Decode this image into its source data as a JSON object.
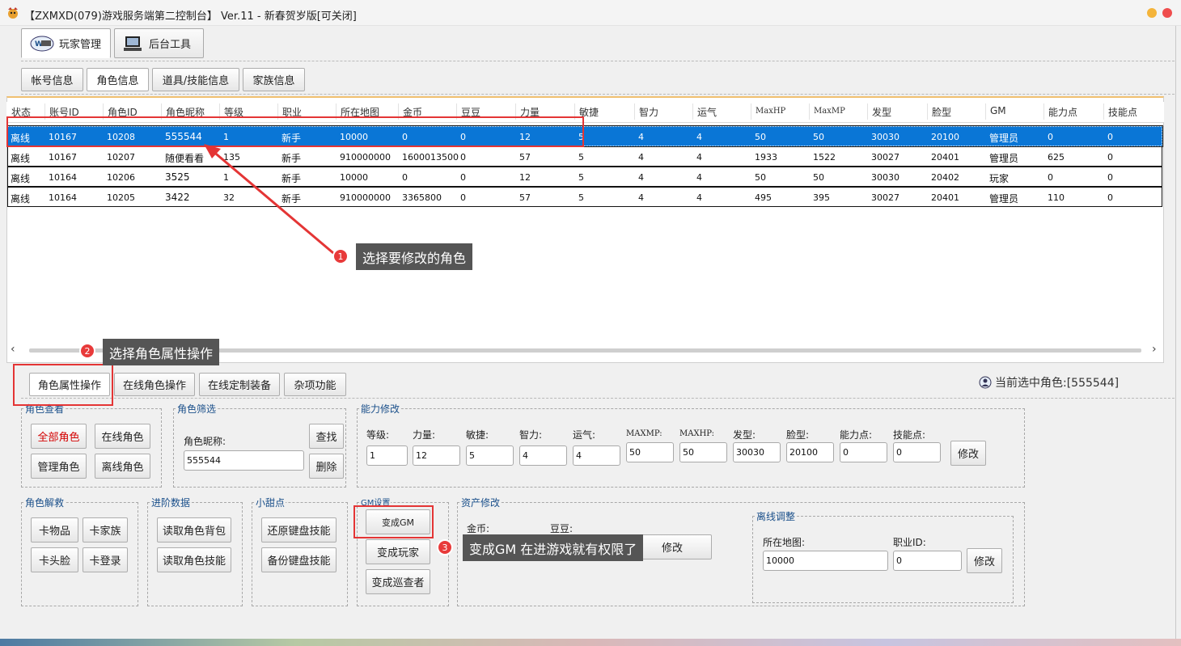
{
  "window": {
    "title": "【ZXMXD(079)游戏服务端第二控制台】 Ver.11 - 新春贺岁版[可关闭]"
  },
  "main_tabs": [
    {
      "label": "玩家管理",
      "icon": "player-manage-icon"
    },
    {
      "label": "后台工具",
      "icon": "computer-icon"
    }
  ],
  "sub_tabs": [
    "帐号信息",
    "角色信息",
    "道具/技能信息",
    "家族信息"
  ],
  "table": {
    "columns": [
      "状态",
      "账号ID",
      "角色ID",
      "角色昵称",
      "等级",
      "职业",
      "所在地图",
      "金币",
      "豆豆",
      "力量",
      "敏捷",
      "智力",
      "运气",
      "MaxHP",
      "MaxMP",
      "发型",
      "脸型",
      "GM",
      "能力点",
      "技能点"
    ],
    "rows": [
      [
        "离线",
        "10167",
        "10208",
        "555544",
        "1",
        "新手",
        "10000",
        "0",
        "0",
        "12",
        "5",
        "4",
        "4",
        "50",
        "50",
        "30030",
        "20100",
        "管理员",
        "0",
        "0"
      ],
      [
        "离线",
        "10167",
        "10207",
        "随便看看",
        "135",
        "新手",
        "910000000",
        "1600013500",
        "0",
        "57",
        "5",
        "4",
        "4",
        "1933",
        "1522",
        "30027",
        "20401",
        "管理员",
        "625",
        "0"
      ],
      [
        "离线",
        "10164",
        "10206",
        "3525",
        "1",
        "新手",
        "10000",
        "0",
        "0",
        "12",
        "5",
        "4",
        "4",
        "50",
        "50",
        "30030",
        "20402",
        "玩家",
        "0",
        "0"
      ],
      [
        "离线",
        "10164",
        "10205",
        "3422",
        "32",
        "新手",
        "910000000",
        "3365800",
        "0",
        "57",
        "5",
        "4",
        "4",
        "495",
        "395",
        "30027",
        "20401",
        "管理员",
        "110",
        "0"
      ]
    ]
  },
  "op_tabs": [
    "角色属性操作",
    "在线角色操作",
    "在线定制装备",
    "杂项功能"
  ],
  "selected_role": "当前选中角色:[555544]",
  "groups": {
    "view": {
      "title": "角色查看",
      "buttons": [
        "全部角色",
        "在线角色",
        "管理角色",
        "离线角色"
      ]
    },
    "filter": {
      "title": "角色筛选",
      "label": "角色昵称:",
      "value": "555544",
      "search": "查找",
      "delete": "删除"
    },
    "ability": {
      "title": "能力修改",
      "fields": [
        {
          "label": "等级:",
          "value": "1"
        },
        {
          "label": "力量:",
          "value": "12"
        },
        {
          "label": "敏捷:",
          "value": "5"
        },
        {
          "label": "智力:",
          "value": "4"
        },
        {
          "label": "运气:",
          "value": "4"
        },
        {
          "label": "MAXMP:",
          "value": "50"
        },
        {
          "label": "MAXHP:",
          "value": "50"
        },
        {
          "label": "发型:",
          "value": "30030"
        },
        {
          "label": "脸型:",
          "value": "20100"
        },
        {
          "label": "能力点:",
          "value": "0"
        },
        {
          "label": "技能点:",
          "value": "0"
        }
      ],
      "modify": "修改"
    },
    "rescue": {
      "title": "角色解救",
      "buttons": [
        "卡物品",
        "卡家族",
        "卡头脸",
        "卡登录"
      ]
    },
    "advanced": {
      "title": "进阶数据",
      "buttons": [
        "读取角色背包",
        "读取角色技能"
      ]
    },
    "tips": {
      "title": "小甜点",
      "buttons": [
        "还原键盘技能",
        "备份键盘技能"
      ]
    },
    "gm": {
      "title": "GM设置",
      "buttons": [
        "变成GM",
        "变成玩家",
        "变成巡查者"
      ]
    },
    "assets": {
      "title": "资产修改",
      "gold_label": "金币:",
      "bean_label": "豆豆:",
      "modify": "修改"
    },
    "offline": {
      "title": "离线调整",
      "map_label": "所在地图:",
      "map_value": "10000",
      "job_label": "职业ID:",
      "job_value": "0",
      "modify": "修改"
    }
  },
  "annotations": [
    {
      "num": "1",
      "text": "选择要修改的角色"
    },
    {
      "num": "2",
      "text": "选择角色属性操作"
    },
    {
      "num": "3",
      "text": "变成GM 在进游戏就有权限了"
    }
  ],
  "colors": {
    "selected_row": "#0a76d6",
    "annotation_red": "#e43535",
    "legend_blue": "#1a4f8a"
  }
}
